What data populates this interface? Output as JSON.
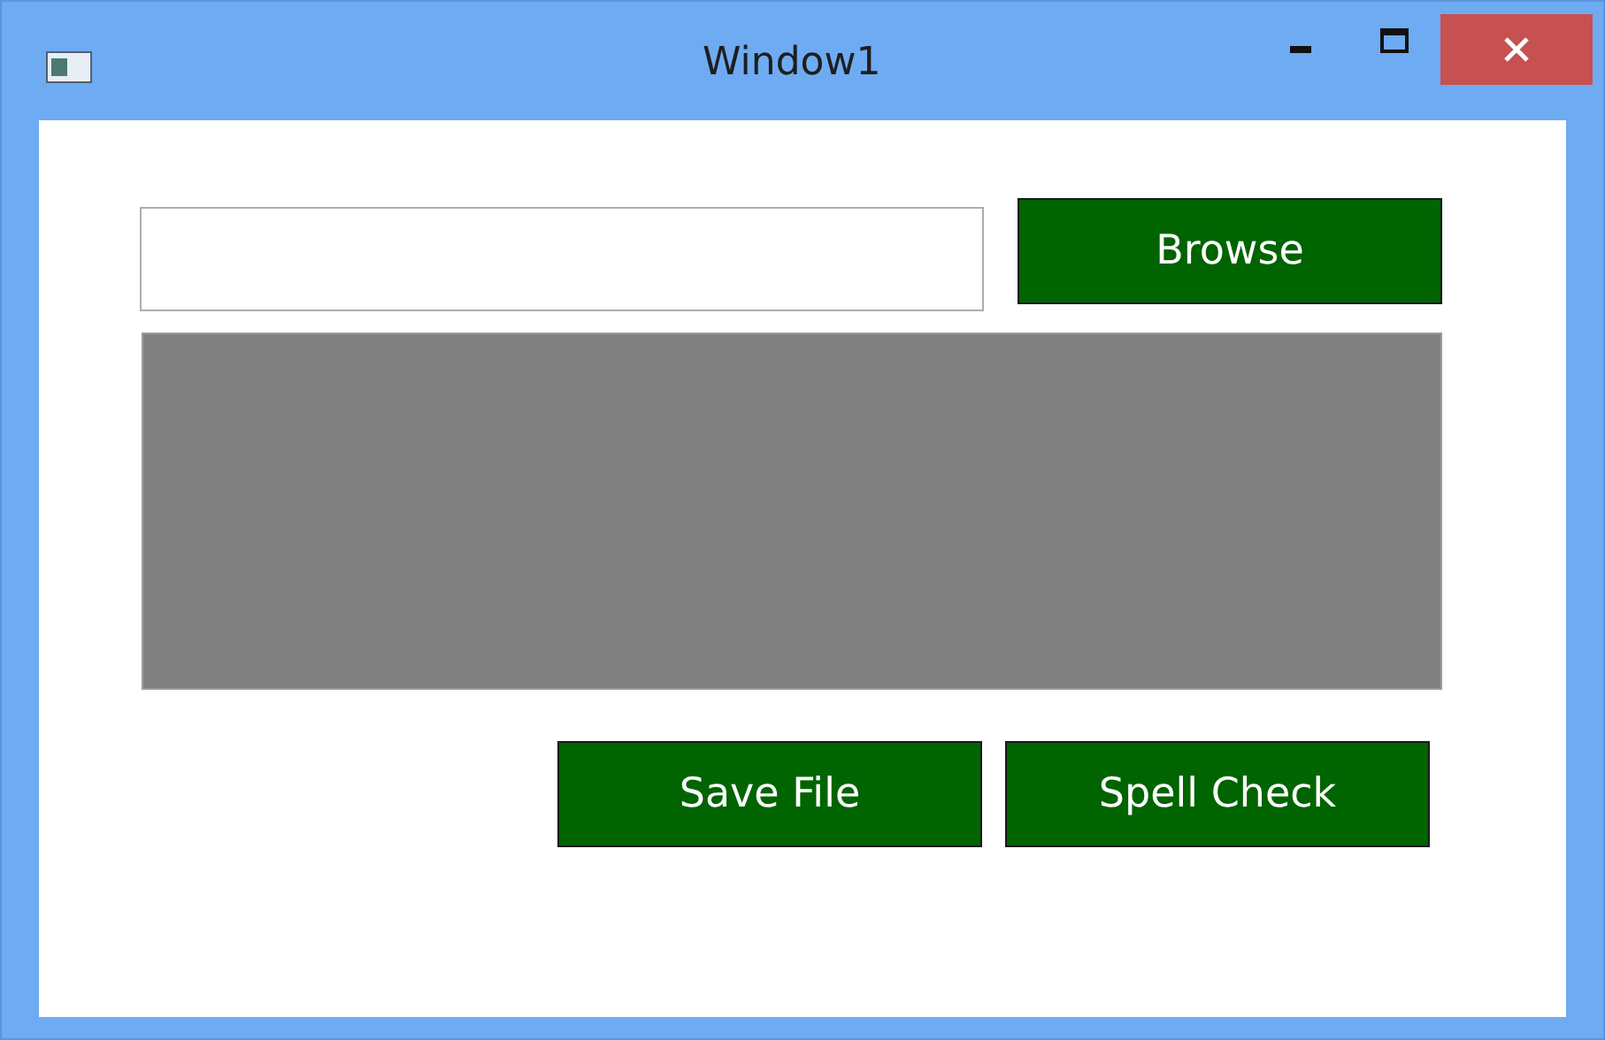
{
  "window": {
    "title": "Window1"
  },
  "top_row": {
    "buttons": [
      {
        "label": "Browse"
      }
    ]
  },
  "bottom_row": {
    "buttons": [
      {
        "label": "Save File"
      },
      {
        "label": "Spell Check"
      }
    ]
  }
}
